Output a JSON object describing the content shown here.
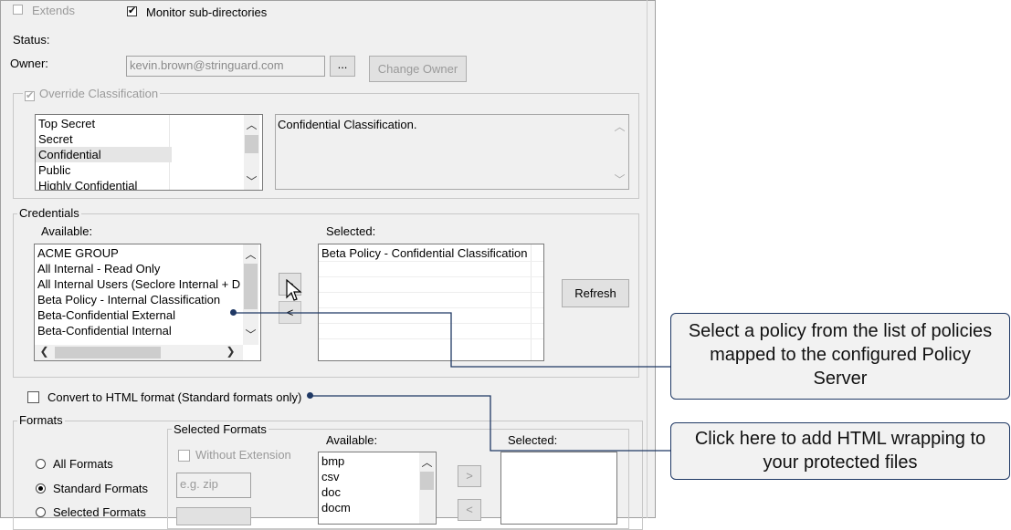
{
  "options": {
    "extends_label": "Extends",
    "extends_checked": false,
    "monitor_label": "Monitor sub-directories",
    "monitor_checked": true
  },
  "status": {
    "label": "Status:"
  },
  "owner": {
    "label": "Owner:",
    "value": "kevin.brown@stringuard.com",
    "browse_label": "...",
    "change_label": "Change Owner"
  },
  "classification": {
    "override_label": "Override Classification",
    "override_checked": true,
    "items": [
      "Top Secret",
      "Secret",
      "Confidential",
      "Public",
      "Highly Confidential"
    ],
    "selected_index": 2,
    "description": "Confidential Classification."
  },
  "credentials": {
    "group_label": "Credentials",
    "available_label": "Available:",
    "selected_label": "Selected:",
    "available_items": [
      "ACME GROUP",
      "All Internal - Read Only",
      "All Internal Users (Seclore Internal + D",
      "Beta Policy - Internal Classification",
      "Beta-Confidential External",
      "Beta-Confidential Internal"
    ],
    "selected_items": [
      "Beta Policy - Confidential Classification"
    ],
    "add_label": ">",
    "remove_label": "<",
    "refresh_label": "Refresh"
  },
  "html_convert": {
    "label": "Convert to HTML format (Standard formats only)",
    "checked": false
  },
  "formats": {
    "group_label": "Formats",
    "radios": [
      {
        "label": "All Formats",
        "selected": false
      },
      {
        "label": "Standard Formats",
        "selected": true
      },
      {
        "label": "Selected Formats",
        "selected": false
      }
    ],
    "selected_formats_label": "Selected Formats",
    "without_extension_label": "Without Extension",
    "extension_placeholder": "e.g. zip",
    "available_label": "Available:",
    "available_items": [
      "bmp",
      "csv",
      "doc",
      "docm"
    ],
    "selected_label": "Selected:",
    "add_label": ">",
    "remove_label": "<"
  },
  "callouts": {
    "policy_text": "Select a policy from the list of policies mapped to the configured Policy Server",
    "html_text": "Click here to add HTML wrapping to your protected files",
    "color": "#1f3864"
  }
}
